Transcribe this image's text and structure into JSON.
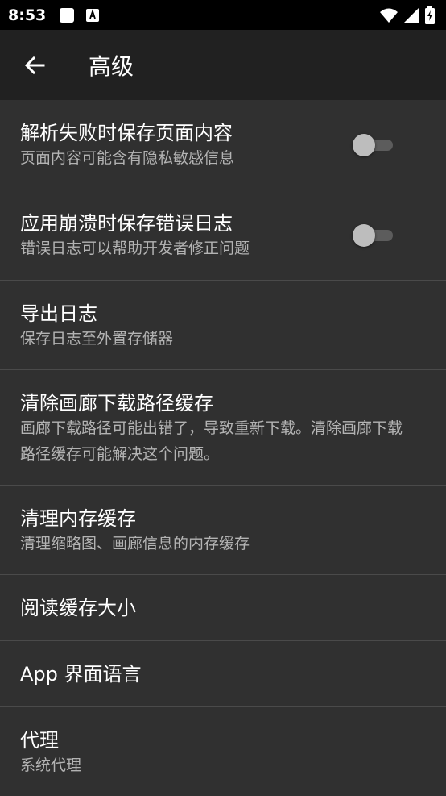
{
  "status_bar": {
    "time": "8:53"
  },
  "app_bar": {
    "title": "高级"
  },
  "settings": [
    {
      "title": "解析失败时保存页面内容",
      "subtitle": "页面内容可能含有隐私敏感信息",
      "toggle": false
    },
    {
      "title": "应用崩溃时保存错误日志",
      "subtitle": "错误日志可以帮助开发者修正问题",
      "toggle": false
    },
    {
      "title": "导出日志",
      "subtitle": "保存日志至外置存储器"
    },
    {
      "title": "清除画廊下载路径缓存",
      "subtitle": "画廊下载路径可能出错了，导致重新下载。清除画廊下载路径缓存可能解决这个问题。"
    },
    {
      "title": "清理内存缓存",
      "subtitle": "清理缩略图、画廊信息的内存缓存"
    },
    {
      "title": "阅读缓存大小"
    },
    {
      "title": "App 界面语言"
    },
    {
      "title": "代理",
      "subtitle": "系统代理"
    }
  ],
  "colors": {
    "background": "#303030",
    "app_bar": "#212121",
    "status_bar": "#000000",
    "divider": "#4a4a4a",
    "subtitle": "#b3b3b3"
  }
}
